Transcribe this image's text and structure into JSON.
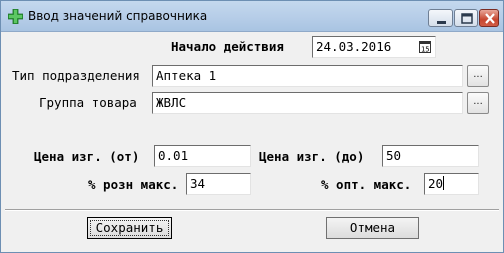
{
  "window": {
    "title": "Ввод значений справочника",
    "icon": "green-cross-icon"
  },
  "titlebar_buttons": [
    "minimize-icon",
    "maximize-icon",
    "close-icon"
  ],
  "form": {
    "start_label": "Начало действия",
    "start_value": "24.03.2016",
    "start_picker_icon": "calendar-icon",
    "subdivision_label": "Тип подразделения",
    "subdivision_value": "Аптека 1",
    "subdivision_browse": "...",
    "group_label": "Группа товара",
    "group_value": "ЖВЛС",
    "group_browse": "...",
    "price_from_label": "Цена изг. (от)",
    "price_from_value": "0.01",
    "price_to_label": "Цена изг. (до)",
    "price_to_value": "50",
    "retail_label": "% розн макс.",
    "retail_value": "34",
    "wholesale_label": "% опт. макс.",
    "wholesale_value": "20"
  },
  "buttons": {
    "save": "Сохранить",
    "cancel": "Отмена"
  },
  "colors": {
    "titlebar": "#b6cde8",
    "close_button": "#c7462f",
    "window_bg": "#f0f0f0"
  }
}
